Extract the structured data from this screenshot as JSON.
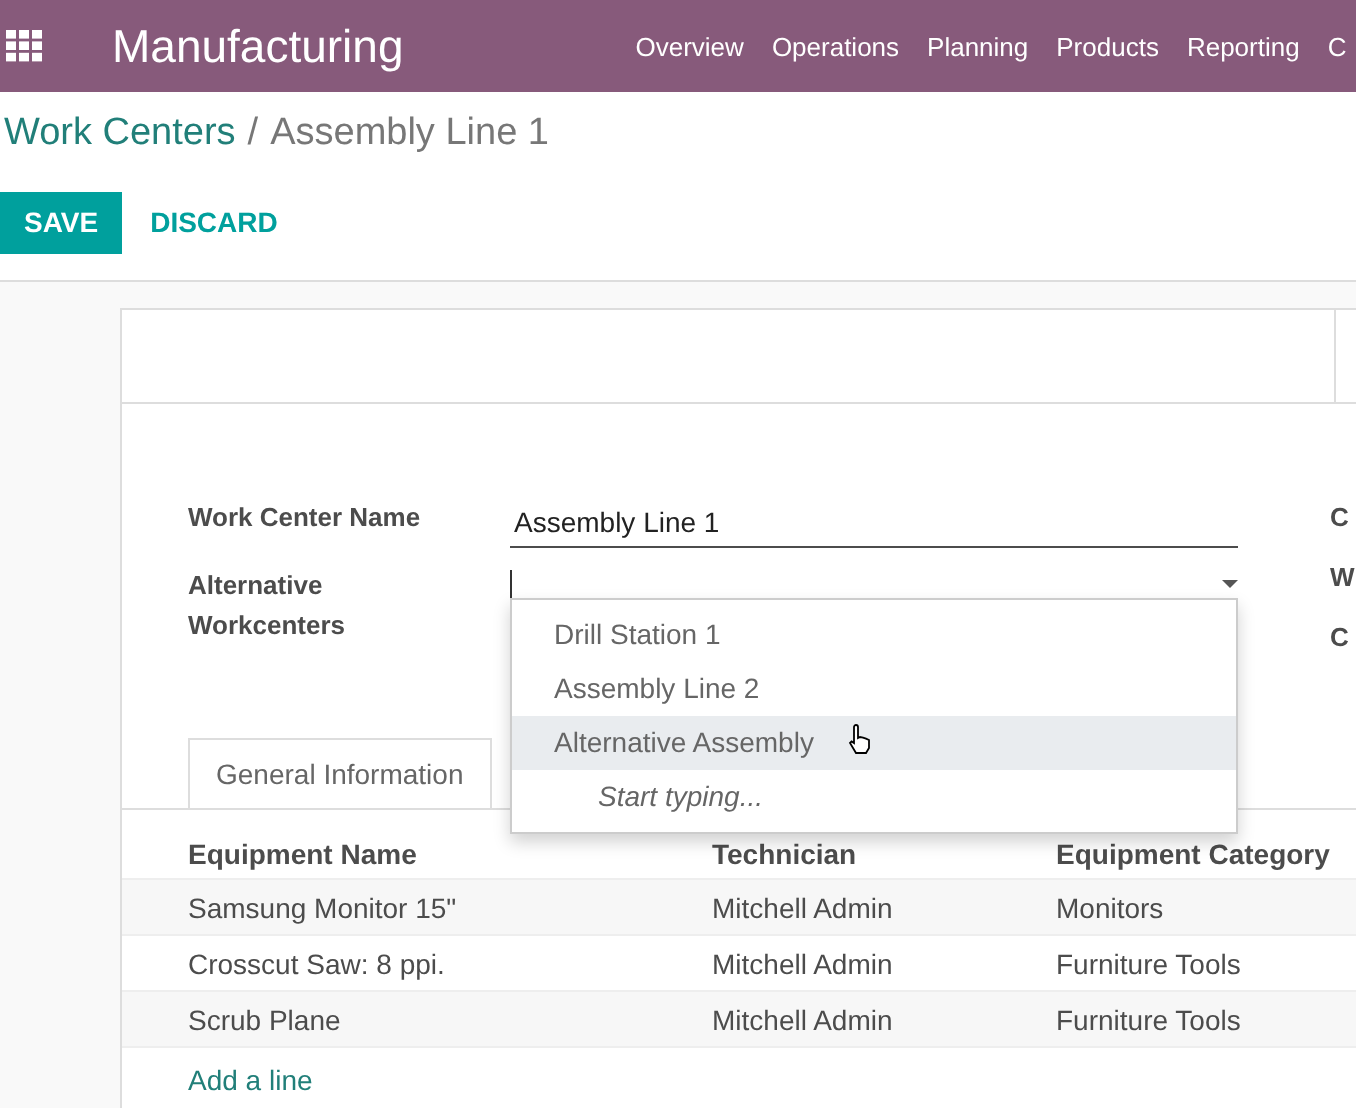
{
  "navbar": {
    "app_name": "Manufacturing",
    "menu": [
      "Overview",
      "Operations",
      "Planning",
      "Products",
      "Reporting",
      "C"
    ]
  },
  "breadcrumb": {
    "parent": "Work Centers",
    "separator": "/",
    "current": "Assembly Line 1"
  },
  "buttons": [
    {
      "label": "SAVE",
      "kind": "primary"
    },
    {
      "label": "DISCARD",
      "kind": "link"
    }
  ],
  "form": {
    "fields": [
      {
        "label": "Work Center Name",
        "value": "Assembly Line 1",
        "kind": "text"
      },
      {
        "label": "Alternative Workcenters",
        "kind": "many2many"
      }
    ],
    "right_labels": [
      "C",
      "W",
      "C"
    ],
    "dropdown": {
      "options": [
        {
          "label": "Drill Station 1",
          "selected": false
        },
        {
          "label": "Assembly Line 2",
          "selected": false
        },
        {
          "label": "Alternative Assembly",
          "selected": true
        }
      ],
      "hint": "Start typing..."
    }
  },
  "tabs": [
    {
      "label": "General Information",
      "selected": true
    }
  ],
  "table": {
    "columns": [
      "Equipment Name",
      "Technician",
      "Equipment Category"
    ],
    "rows": [
      [
        "Samsung Monitor 15\"",
        "Mitchell Admin",
        "Monitors"
      ],
      [
        "Crosscut Saw: 8 ppi.",
        "Mitchell Admin",
        "Furniture Tools"
      ],
      [
        "Scrub Plane",
        "Mitchell Admin",
        "Furniture Tools"
      ]
    ],
    "add_line": "Add a line"
  }
}
